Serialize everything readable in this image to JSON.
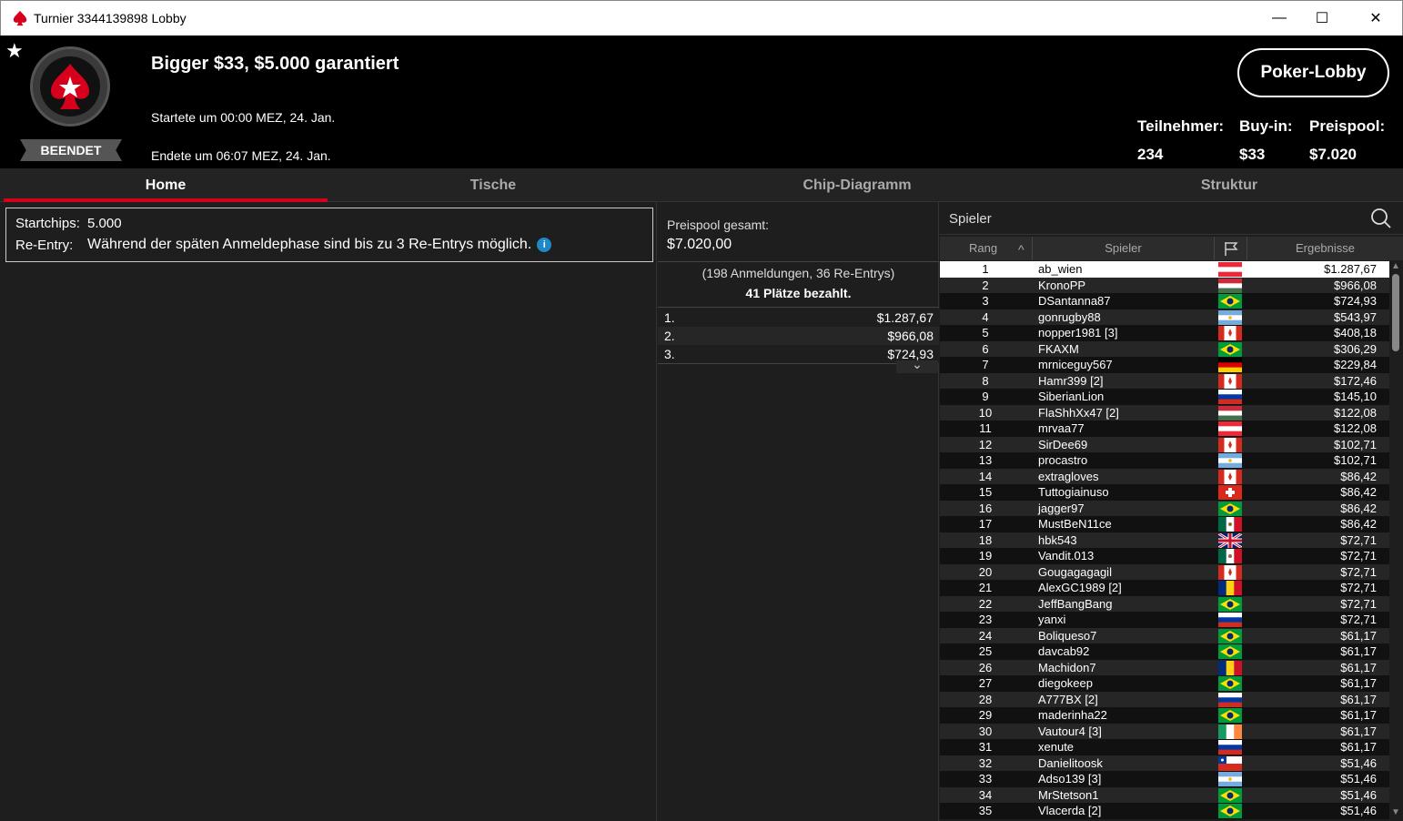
{
  "window": {
    "title": "Turnier 3344139898 Lobby",
    "minimize": "—",
    "maximize": "☐",
    "close": "✕"
  },
  "header": {
    "tournament_name": "Bigger $33, $5.000 garantiert",
    "started": "Startete um 00:00 MEZ, 24. Jan.",
    "ended": "Endete um 06:07 MEZ, 24. Jan.",
    "status": "BEENDET",
    "lobby_button": "Poker-Lobby",
    "stats": [
      {
        "label": "Teilnehmer:",
        "value": "234"
      },
      {
        "label": "Buy-in:",
        "value": "$33"
      },
      {
        "label": "Preispool:",
        "value": "$7.020"
      }
    ]
  },
  "tabs": [
    {
      "label": "Home",
      "active": true
    },
    {
      "label": "Tische",
      "active": false
    },
    {
      "label": "Chip-Diagramm",
      "active": false
    },
    {
      "label": "Struktur",
      "active": false
    }
  ],
  "home": {
    "startchips_label": "Startchips:",
    "startchips_value": "5.000",
    "reentry_label": "Re-Entry:",
    "reentry_value": "Während der späten Anmeldephase sind bis zu 3 Re-Entrys möglich.",
    "info_icon": "i"
  },
  "prizepool": {
    "label": "Preispool gesamt:",
    "value": "$7.020,00",
    "entries": "(198 Anmeldungen, 36 Re-Entrys)",
    "paid": "41 Plätze bezahlt.",
    "places": [
      {
        "pos": "1.",
        "amount": "$1.287,67"
      },
      {
        "pos": "2.",
        "amount": "$966,08"
      },
      {
        "pos": "3.",
        "amount": "$724,93"
      }
    ],
    "expand_icon": "⌄"
  },
  "players": {
    "search_placeholder": "Spieler",
    "columns": {
      "rank": "Rang",
      "sort_icon": "^",
      "player": "Spieler",
      "results": "Ergebnisse"
    },
    "rows": [
      {
        "rank": "1",
        "name": "ab_wien",
        "flag": "austria",
        "result": "$1.287,67"
      },
      {
        "rank": "2",
        "name": "KronoPP",
        "flag": "hungary",
        "result": "$966,08"
      },
      {
        "rank": "3",
        "name": "DSantanna87",
        "flag": "brazil",
        "result": "$724,93"
      },
      {
        "rank": "4",
        "name": "gonrugby88",
        "flag": "argentina",
        "result": "$543,97"
      },
      {
        "rank": "5",
        "name": "nopper1981 [3]",
        "flag": "canada",
        "result": "$408,18"
      },
      {
        "rank": "6",
        "name": "FKAXM",
        "flag": "brazil",
        "result": "$306,29"
      },
      {
        "rank": "7",
        "name": "mrniceguy567",
        "flag": "germany",
        "result": "$229,84"
      },
      {
        "rank": "8",
        "name": "Hamr399 [2]",
        "flag": "canada",
        "result": "$172,46"
      },
      {
        "rank": "9",
        "name": "SiberianLion",
        "flag": "russia",
        "result": "$145,10"
      },
      {
        "rank": "10",
        "name": "FlaShhXx47 [2]",
        "flag": "hungary",
        "result": "$122,08"
      },
      {
        "rank": "11",
        "name": "mrvaa77",
        "flag": "austria",
        "result": "$122,08"
      },
      {
        "rank": "12",
        "name": "SirDee69",
        "flag": "canada",
        "result": "$102,71"
      },
      {
        "rank": "13",
        "name": "procastro",
        "flag": "argentina",
        "result": "$102,71"
      },
      {
        "rank": "14",
        "name": "extragloves",
        "flag": "canada",
        "result": "$86,42"
      },
      {
        "rank": "15",
        "name": "Tuttogiainuso",
        "flag": "switzerland",
        "result": "$86,42"
      },
      {
        "rank": "16",
        "name": "jagger97",
        "flag": "brazil",
        "result": "$86,42"
      },
      {
        "rank": "17",
        "name": "MustBeN11ce",
        "flag": "mexico",
        "result": "$86,42"
      },
      {
        "rank": "18",
        "name": "hbk543",
        "flag": "uk",
        "result": "$72,71"
      },
      {
        "rank": "19",
        "name": "Vandit.013",
        "flag": "mexico",
        "result": "$72,71"
      },
      {
        "rank": "20",
        "name": "Gougagagagil",
        "flag": "canada",
        "result": "$72,71"
      },
      {
        "rank": "21",
        "name": "AlexGC1989 [2]",
        "flag": "romania",
        "result": "$72,71"
      },
      {
        "rank": "22",
        "name": "JeffBangBang",
        "flag": "brazil",
        "result": "$72,71"
      },
      {
        "rank": "23",
        "name": "yanxi",
        "flag": "russia",
        "result": "$72,71"
      },
      {
        "rank": "24",
        "name": "Boliqueso7",
        "flag": "brazil",
        "result": "$61,17"
      },
      {
        "rank": "25",
        "name": "davcab92",
        "flag": "brazil",
        "result": "$61,17"
      },
      {
        "rank": "26",
        "name": "Machidon7",
        "flag": "romania",
        "result": "$61,17"
      },
      {
        "rank": "27",
        "name": "diegokeep",
        "flag": "brazil",
        "result": "$61,17"
      },
      {
        "rank": "28",
        "name": "A777BX [2]",
        "flag": "russia",
        "result": "$61,17"
      },
      {
        "rank": "29",
        "name": "maderinha22",
        "flag": "brazil",
        "result": "$61,17"
      },
      {
        "rank": "30",
        "name": "Vautour4 [3]",
        "flag": "ireland",
        "result": "$61,17"
      },
      {
        "rank": "31",
        "name": "xenute",
        "flag": "russia",
        "result": "$61,17"
      },
      {
        "rank": "32",
        "name": "Danielitoosk",
        "flag": "chile",
        "result": "$51,46"
      },
      {
        "rank": "33",
        "name": "Adso139 [3]",
        "flag": "argentina",
        "result": "$51,46"
      },
      {
        "rank": "34",
        "name": "MrStetson1",
        "flag": "brazil",
        "result": "$51,46"
      },
      {
        "rank": "35",
        "name": "Vlacerda [2]",
        "flag": "brazil",
        "result": "$51,46"
      }
    ]
  },
  "colors": {
    "accent": "#d6001c",
    "background": "#1e1e1e",
    "header": "#000000"
  }
}
